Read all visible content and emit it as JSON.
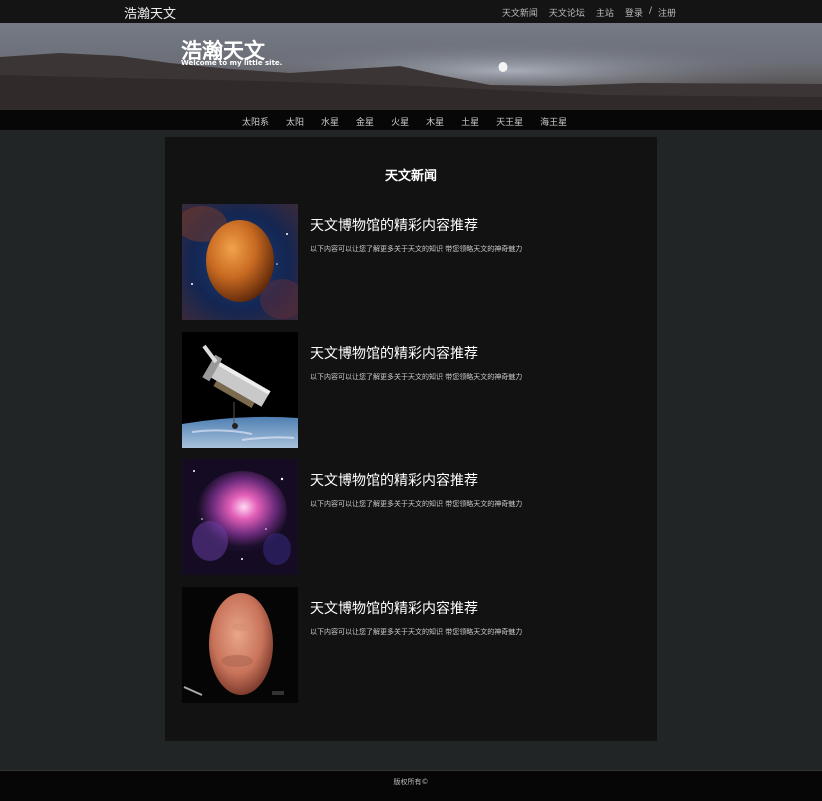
{
  "header": {
    "brand": "浩瀚天文",
    "nav": [
      "天文新闻",
      "天文论坛",
      "主站",
      "登录",
      "/",
      "注册"
    ]
  },
  "banner": {
    "title": "浩瀚天文",
    "subtitle": "Welcome to my little site."
  },
  "category_nav": [
    "太阳系",
    "太阳",
    "水星",
    "金星",
    "火星",
    "木星",
    "土星",
    "天王星",
    "海王星"
  ],
  "main": {
    "heading": "天文新闻",
    "items": [
      {
        "title": "天文博物馆的精彩内容推荐",
        "desc": "以下内容可以让您了解更多关于天文的知识 带您领略天文的神奇魅力",
        "image": "venus-image"
      },
      {
        "title": "天文博物馆的精彩内容推荐",
        "desc": "以下内容可以让您了解更多关于天文的知识 带您领略天文的神奇魅力",
        "image": "telescope-image"
      },
      {
        "title": "天文博物馆的精彩内容推荐",
        "desc": "以下内容可以让您了解更多关于天文的知识 带您领略天文的神奇魅力",
        "image": "nebula-image"
      },
      {
        "title": "天文博物馆的精彩内容推荐",
        "desc": "以下内容可以让您了解更多关于天文的知识 带您领略天文的神奇魅力",
        "image": "mars-image"
      }
    ]
  },
  "footer": {
    "copyright": "版权所有©"
  }
}
